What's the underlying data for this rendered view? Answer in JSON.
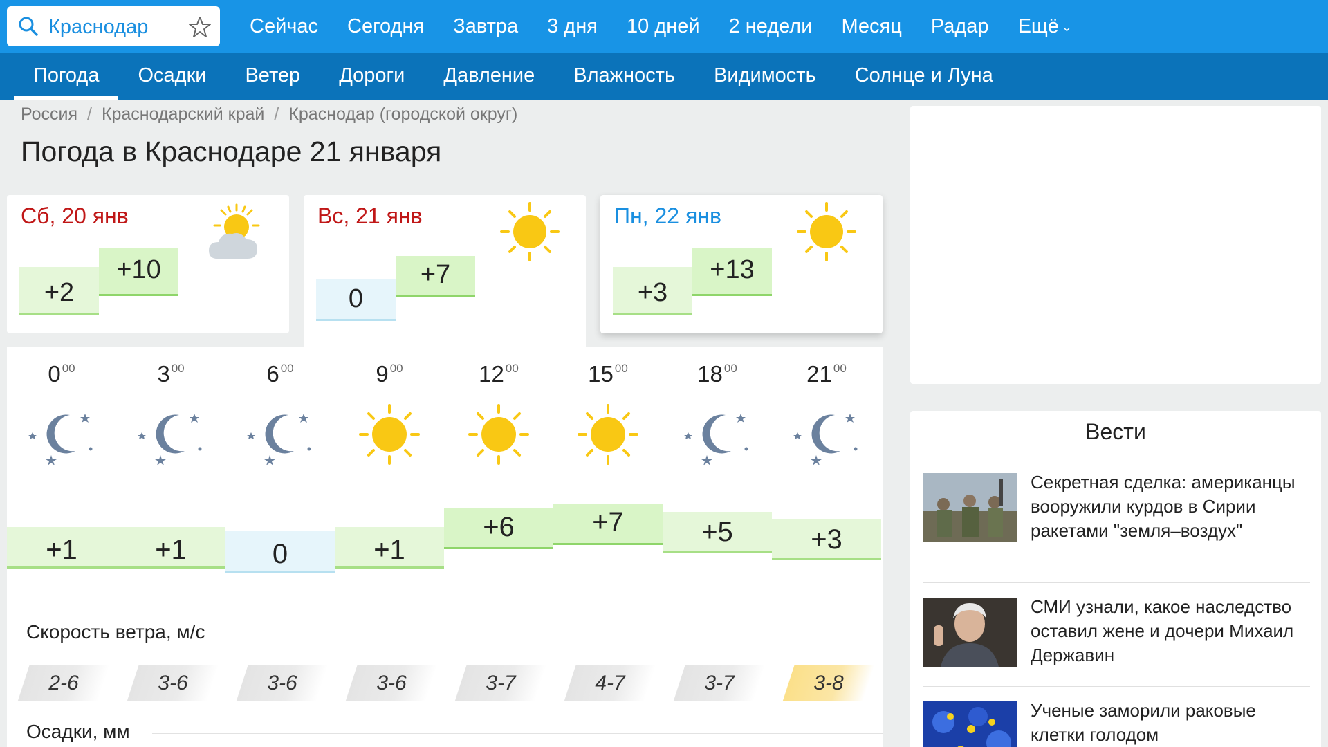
{
  "search": {
    "value": "Краснодар"
  },
  "top_nav": [
    "Сейчас",
    "Сегодня",
    "Завтра",
    "3 дня",
    "10 дней",
    "2 недели",
    "Месяц",
    "Радар",
    "Ещё"
  ],
  "sub_nav": [
    "Погода",
    "Осадки",
    "Ветер",
    "Дороги",
    "Давление",
    "Влажность",
    "Видимость",
    "Солнце и Луна"
  ],
  "breadcrumb": [
    "Россия",
    "Краснодарский край",
    "Краснодар (городской округ)"
  ],
  "page_title": "Погода в Краснодаре 21 января",
  "days": [
    {
      "label": "Сб, 20 янв",
      "icon": "partly-cloudy-icon",
      "min": "+2",
      "max": "+10"
    },
    {
      "label": "Вс, 21 янв",
      "icon": "sun-icon",
      "min": "0",
      "max": "+7"
    },
    {
      "label": "Пн, 22 янв",
      "icon": "sun-icon",
      "min": "+3",
      "max": "+13"
    }
  ],
  "hourly": {
    "minutes": "00",
    "items": [
      {
        "hour": "0",
        "icon": "moon-icon",
        "temp": "+1",
        "wind": "2-6"
      },
      {
        "hour": "3",
        "icon": "moon-icon",
        "temp": "+1",
        "wind": "3-6"
      },
      {
        "hour": "6",
        "icon": "moon-icon",
        "temp": "0",
        "wind": "3-6"
      },
      {
        "hour": "9",
        "icon": "sun-icon",
        "temp": "+1",
        "wind": "3-6"
      },
      {
        "hour": "12",
        "icon": "sun-icon",
        "temp": "+6",
        "wind": "3-7"
      },
      {
        "hour": "15",
        "icon": "sun-icon",
        "temp": "+7",
        "wind": "4-7"
      },
      {
        "hour": "18",
        "icon": "moon-icon",
        "temp": "+5",
        "wind": "3-7"
      },
      {
        "hour": "21",
        "icon": "moon-icon",
        "temp": "+3",
        "wind": "3-8"
      }
    ]
  },
  "wind_label": "Скорость ветра, м/с",
  "precip_label": "Осадки, мм",
  "news": {
    "heading": "Вести",
    "items": [
      {
        "text": "Секретная сделка: американцы вооружили курдов в Сирии ракетами \"земля–воздух\""
      },
      {
        "text": "СМИ узнали, какое наследство оставил жене и дочери Михаил Державин"
      },
      {
        "text": "Ученые заморили раковые клетки голодом"
      }
    ]
  },
  "colors": {
    "topbar": "#1894e6",
    "subbar": "#0b73ba",
    "weekend": "#c01717",
    "weekday": "#1a8fe0",
    "sun": "#f9c814",
    "moon": "#6b819e"
  }
}
